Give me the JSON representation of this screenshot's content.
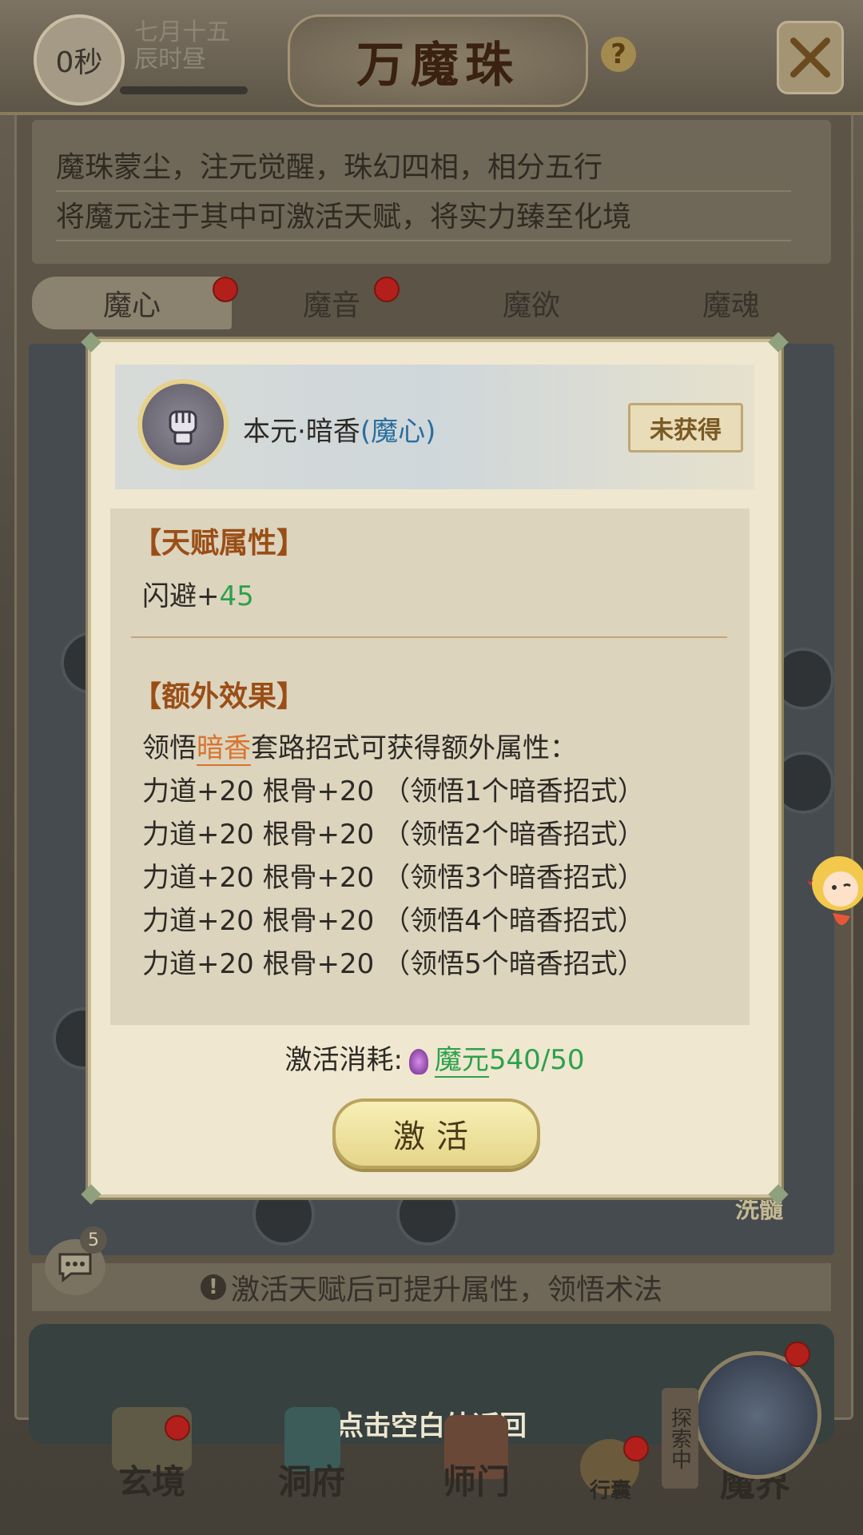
{
  "topbar": {
    "timer": "0秒",
    "date_line1": "七月十五",
    "date_line2": "辰时昼",
    "title": "万魔珠",
    "help": "?"
  },
  "description": {
    "line1": "魔珠蒙尘，注元觉醒，珠幻四相，相分五行",
    "line2": "将魔元注于其中可激活天赋，将实力臻至化境"
  },
  "tabs": [
    {
      "label": "魔心",
      "has_dot": true,
      "active": true
    },
    {
      "label": "魔音",
      "has_dot": true,
      "active": false
    },
    {
      "label": "魔欲",
      "has_dot": false,
      "active": false
    },
    {
      "label": "魔魂",
      "has_dot": false,
      "active": false
    }
  ],
  "modal": {
    "skill_name": "本元·暗香",
    "skill_school": "(魔心)",
    "status": "未获得",
    "talent_title": "【天赋属性】",
    "talent_attr_name": "闪避+",
    "talent_attr_value": "45",
    "extra_title": "【额外效果】",
    "extra_intro_prefix": "领悟",
    "extra_intro_highlight": "暗香",
    "extra_intro_suffix": "套路招式可获得额外属性：",
    "extra_lines": [
      "力道+20 根骨+20 （领悟1个暗香招式）",
      "力道+20 根骨+20 （领悟2个暗香招式）",
      "力道+20 根骨+20 （领悟3个暗香招式）",
      "力道+20 根骨+20 （领悟4个暗香招式）",
      "力道+20 根骨+20 （领悟5个暗香招式）"
    ],
    "cost_label": "激活消耗:",
    "cost_resource": "魔元",
    "cost_amount": "540/50",
    "activate_label": "激活"
  },
  "map": {
    "xisui": "洗髓"
  },
  "tip": "激活天赋后可提升属性，领悟术法",
  "chat": {
    "badge": "5"
  },
  "hint": "点击空白处返回",
  "explore_tag": "探索中",
  "nav": [
    {
      "label": "玄境"
    },
    {
      "label": "洞府"
    },
    {
      "label": "师门"
    },
    {
      "label": "行囊"
    },
    {
      "label": "魔界"
    }
  ],
  "colors": {
    "accent_green": "#2ca14c",
    "highlight_orange": "#d8742e",
    "section_brown": "#9a4e16",
    "red_dot": "#b3201b"
  }
}
